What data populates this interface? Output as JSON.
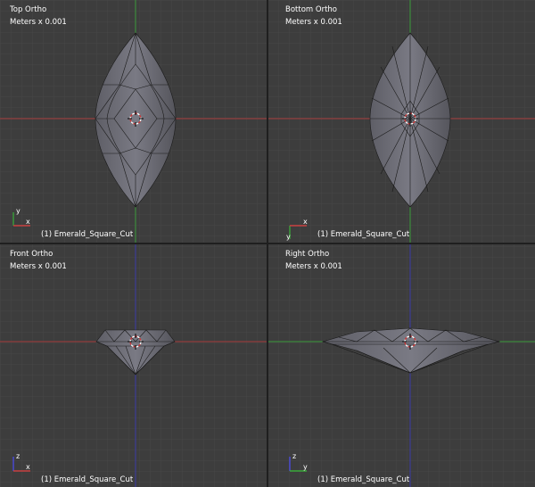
{
  "viewports": [
    {
      "id": "top",
      "view_name": "Top Ortho",
      "scale_label": "Meters x 0.001",
      "object_label": "(1) Emerald_Square_Cut",
      "axes": [
        "y",
        "x"
      ]
    },
    {
      "id": "bottom",
      "view_name": "Bottom Ortho",
      "scale_label": "Meters x 0.001",
      "object_label": "(1) Emerald_Square_Cut",
      "axes": [
        "y",
        "x"
      ]
    },
    {
      "id": "front",
      "view_name": "Front Ortho",
      "scale_label": "Meters x 0.001",
      "object_label": "(1) Emerald_Square_Cut",
      "axes": [
        "z",
        "x"
      ]
    },
    {
      "id": "right",
      "view_name": "Right Ortho",
      "scale_label": "Meters x 0.001",
      "object_label": "(1) Emerald_Square_Cut",
      "axes": [
        "z",
        "y"
      ]
    }
  ],
  "colors": {
    "background": "#3d3d3d",
    "grid_minor": "#454545",
    "grid_major": "#353535",
    "separator": "#1f1f1f",
    "axis_x": "#a63a3a",
    "axis_y": "#3a9a3a",
    "axis_z": "#3a3aa8",
    "mesh_fill": "#6f6f78",
    "mesh_edge": "#1a1a1a",
    "cursor_ring": "#cc3333"
  }
}
